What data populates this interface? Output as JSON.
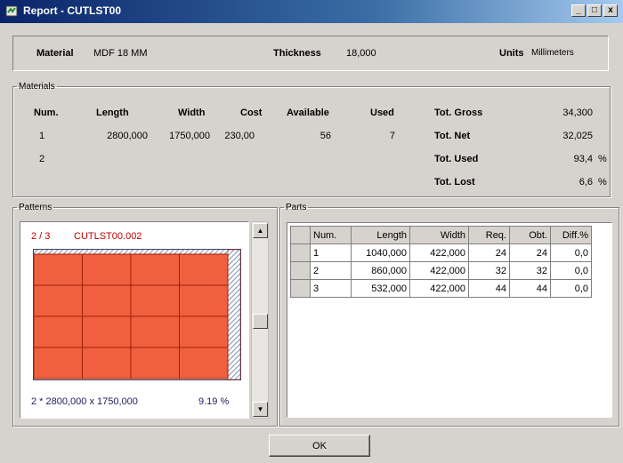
{
  "window": {
    "title": "Report - CUTLST00",
    "controls": [
      "_",
      "□",
      "x"
    ]
  },
  "top": {
    "material_label": "Material",
    "material_value": "MDF 18 MM",
    "thickness_label": "Thickness",
    "thickness_value": "18,000",
    "units_label": "Units",
    "units_value": "Millimeters"
  },
  "materials": {
    "legend": "Materials",
    "headers": [
      "Num.",
      "Length",
      "Width",
      "Cost",
      "Available",
      "Used"
    ],
    "rows": [
      [
        "1",
        "2800,000",
        "1750,000",
        "230,00",
        "56",
        "7"
      ],
      [
        "2",
        "",
        "",
        "",
        "",
        ""
      ]
    ],
    "totals": [
      {
        "label": "Tot. Gross",
        "value": "34,300",
        "unit": ""
      },
      {
        "label": "Tot. Net",
        "value": "32,025",
        "unit": ""
      },
      {
        "label": "Tot. Used",
        "value": "93,4",
        "unit": "%"
      },
      {
        "label": "Tot. Lost",
        "value": "6,6",
        "unit": "%"
      }
    ]
  },
  "patterns": {
    "legend": "Patterns",
    "index": "2 / 3",
    "name": "CUTLST00.002",
    "footer_left": "2 * 2800,000 x 1750,000",
    "footer_right": "9.19 %",
    "colors": {
      "piece": "#f06040",
      "grid": "#a02000",
      "waste": "#c8d0e0"
    }
  },
  "parts": {
    "legend": "Parts",
    "headers": [
      "Num.",
      "Length",
      "Width",
      "Req.",
      "Obt.",
      "Diff.%"
    ],
    "rows": [
      [
        "1",
        "1040,000",
        "422,000",
        "24",
        "24",
        "0,0"
      ],
      [
        "2",
        "860,000",
        "422,000",
        "32",
        "32",
        "0,0"
      ],
      [
        "3",
        "532,000",
        "422,000",
        "44",
        "44",
        "0,0"
      ]
    ]
  },
  "ok_label": "OK"
}
